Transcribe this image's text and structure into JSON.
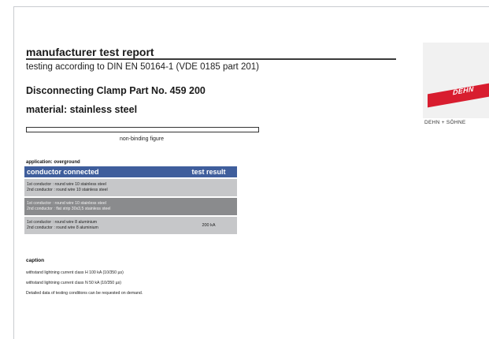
{
  "report": {
    "title": "manufacturer test report",
    "subtitle": "testing according to DIN EN 50164-1 (VDE 0185 part 201)",
    "product": "Disconnecting Clamp   Part No. 459 200",
    "material": "material:  stainless steel",
    "figure_caption": "non-binding figure",
    "application": "application:  overground"
  },
  "table": {
    "headers": [
      "conductor connected",
      "test result"
    ],
    "rows": [
      {
        "line1": "1st conductor : round wire 10 stainless steel",
        "line2": "2nd conductor : round wire 10 stainless steel",
        "result": ""
      },
      {
        "line1": "1st conductor : round wire 10 stainless steel",
        "line2": "2nd conductor : flat strip 30x3,5 stainless steel",
        "result": ""
      },
      {
        "line1": "1st conductor : round wire 8 aluminium",
        "line2": "2nd conductor : round wire 8 aluminium",
        "result": "200 kA"
      }
    ]
  },
  "caption": {
    "heading": "caption",
    "lines": [
      "withstand lightning current class H  100 kA (10/350 µs)",
      "withstand lightning current class N   50 kA (10/350 µs)",
      "Detailed data of testing conditions can be requested on demand."
    ]
  },
  "logo": {
    "word": "DEHN",
    "company": "DEHN + SÖHNE"
  },
  "colors": {
    "table_header": "#3f5e9c",
    "row_light": "#c6c7c9",
    "row_dark": "#8a8b8d",
    "logo_red": "#d81d2f"
  }
}
